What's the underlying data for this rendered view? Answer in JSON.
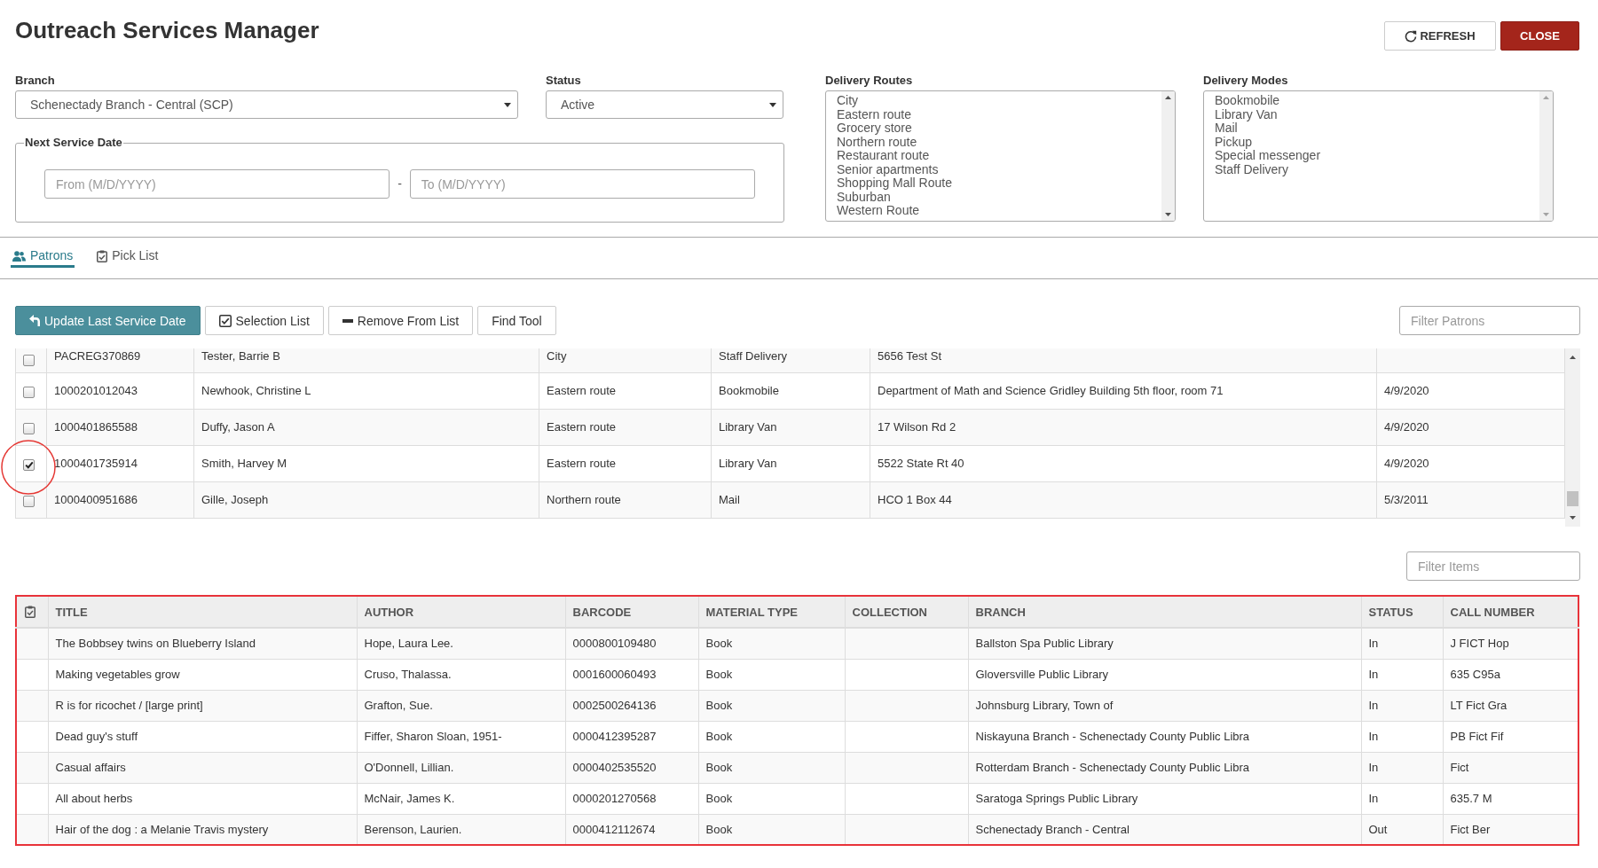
{
  "header": {
    "title": "Outreach Services Manager",
    "buttons": [
      {
        "label": "REFRESH",
        "kind": "refresh"
      },
      {
        "label": "CLOSE",
        "kind": "close"
      }
    ]
  },
  "filters": {
    "branch": {
      "label": "Branch",
      "value": "Schenectady Branch - Central (SCP)"
    },
    "status": {
      "label": "Status",
      "value": "Active"
    },
    "next_service_date": {
      "legend": "Next Service Date",
      "from": {
        "placeholder": "From (M/D/YYYY)"
      },
      "separator": "-",
      "to": {
        "placeholder": "To (M/D/YYYY)"
      }
    },
    "delivery_routes": {
      "label": "Delivery Routes",
      "items": [
        {
          "label": "City",
          "selected": false
        },
        {
          "label": "Eastern route",
          "selected": false
        },
        {
          "label": "Grocery store",
          "selected": false
        },
        {
          "label": "Northern route",
          "selected": false
        },
        {
          "label": "Restaurant route",
          "selected": false
        },
        {
          "label": "Senior apartments",
          "selected": false
        },
        {
          "label": "Shopping Mall Route",
          "selected": false
        },
        {
          "label": "Suburban",
          "selected": false
        },
        {
          "label": "Western Route",
          "selected": false
        }
      ]
    },
    "delivery_modes": {
      "label": "Delivery Modes",
      "items": [
        {
          "label": "Bookmobile",
          "selected": false
        },
        {
          "label": "Library Van",
          "selected": false
        },
        {
          "label": "Mail",
          "selected": false
        },
        {
          "label": "Pickup",
          "selected": false
        },
        {
          "label": "Special messenger",
          "selected": false
        },
        {
          "label": "Staff Delivery",
          "selected": false
        }
      ]
    }
  },
  "tabs": [
    {
      "label": "Patrons",
      "kind": "patrons",
      "selected": true
    },
    {
      "label": "Pick List",
      "kind": "pick_list",
      "selected": false
    }
  ],
  "patrons_toolbar": {
    "buttons": [
      {
        "label": "Update Last Service Date",
        "kind": "update"
      },
      {
        "label": "Selection List",
        "kind": "checklist"
      },
      {
        "label": "Remove From List",
        "kind": "remove"
      },
      {
        "label": "Find Tool",
        "kind": "plain"
      }
    ],
    "filter": {
      "placeholder": "Filter Patrons"
    }
  },
  "patrons_table": {
    "rows": [
      {
        "checked": false,
        "highlighted": false,
        "cells": [
          "PACREG370869",
          "Tester, Barrie B",
          "City",
          "Staff Delivery",
          "5656 Test St"
        ]
      },
      {
        "checked": false,
        "highlighted": false,
        "cells": [
          "1000201012043",
          "Newhook, Christine L",
          "Eastern route",
          "Bookmobile",
          "Department of Math and Science Gridley Building 5th floor, room 71",
          "4/9/2020"
        ]
      },
      {
        "checked": false,
        "highlighted": false,
        "cells": [
          "1000401865588",
          "Duffy, Jason A",
          "Eastern route",
          "Library Van",
          "17 Wilson Rd 2",
          "4/9/2020"
        ]
      },
      {
        "checked": true,
        "highlighted": true,
        "cells": [
          "1000401735914",
          "Smith, Harvey M",
          "Eastern route",
          "Library Van",
          "5522 State Rt 40",
          "4/9/2020"
        ]
      },
      {
        "checked": false,
        "highlighted": false,
        "cells": [
          "1000400951686",
          "Gille, Joseph",
          "Northern route",
          "Mail",
          "HCO 1 Box 44",
          "5/3/2011"
        ]
      }
    ]
  },
  "items_filter": {
    "placeholder": "Filter Items"
  },
  "items_table": {
    "highlighted": true,
    "columns": [
      "TITLE",
      "AUTHOR",
      "BARCODE",
      "MATERIAL TYPE",
      "COLLECTION",
      "BRANCH",
      "STATUS",
      "CALL NUMBER"
    ],
    "rows": [
      {
        "title": "The Bobbsey twins on Blueberry Island",
        "author": "Hope, Laura Lee.",
        "barcode": "0000800109480",
        "material_type": "Book",
        "branch": "Ballston Spa Public Library",
        "status": "In",
        "call_number": "J FICT Hop"
      },
      {
        "title": "Making vegetables grow",
        "author": "Cruso, Thalassa.",
        "barcode": "0001600060493",
        "material_type": "Book",
        "branch": "Gloversville Public Library",
        "status": "In",
        "call_number": "635 C95a"
      },
      {
        "title": "R is for ricochet / [large print]",
        "author": "Grafton, Sue.",
        "barcode": "0002500264136",
        "material_type": "Book",
        "branch": "Johnsburg Library, Town of",
        "status": "In",
        "call_number": "LT Fict Gra"
      },
      {
        "title": "Dead guy's stuff",
        "author": "Fiffer, Sharon Sloan, 1951-",
        "barcode": "0000412395287",
        "material_type": "Book",
        "branch": "Niskayuna Branch - Schenectady County Public Libra",
        "status": "In",
        "call_number": "PB Fict Fif"
      },
      {
        "title": "Casual affairs",
        "author": "O'Donnell, Lillian.",
        "barcode": "0000402535520",
        "material_type": "Book",
        "branch": "Rotterdam Branch - Schenectady County Public Libra",
        "status": "In",
        "call_number": "Fict"
      },
      {
        "title": "All about herbs",
        "author": "McNair, James K.",
        "barcode": "0000201270568",
        "material_type": "Book",
        "branch": "Saratoga Springs Public Library",
        "status": "In",
        "call_number": "635.7 M"
      },
      {
        "title": "Hair of the dog : a Melanie Travis mystery",
        "author": "Berenson, Laurien.",
        "barcode": "0000412112674",
        "material_type": "Book",
        "branch": "Schenectady Branch - Central",
        "status": "Out",
        "call_number": "Fict Ber"
      }
    ]
  }
}
